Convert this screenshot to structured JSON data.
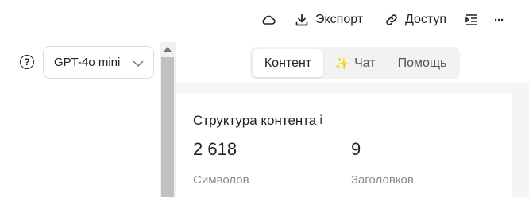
{
  "toolbar": {
    "cloud_icon": "cloud-icon",
    "export_label": "Экспорт",
    "export_icon": "download-icon",
    "access_label": "Доступ",
    "access_icon": "link-icon",
    "outline_icon": "outline-icon",
    "more_label": "···"
  },
  "left_panel": {
    "help_label": "?",
    "model_select": {
      "value": "GPT-4o mini"
    }
  },
  "tabs": [
    {
      "label": "Контент",
      "active": true
    },
    {
      "label": "Чат",
      "icon": "✨",
      "active": false
    },
    {
      "label": "Помощь",
      "active": false
    }
  ],
  "content_structure": {
    "title": "Структура контента",
    "info_mark": "i",
    "stats": [
      {
        "value": "2 618",
        "label": "Символов"
      },
      {
        "value": "9",
        "label": "Заголовков"
      }
    ]
  }
}
